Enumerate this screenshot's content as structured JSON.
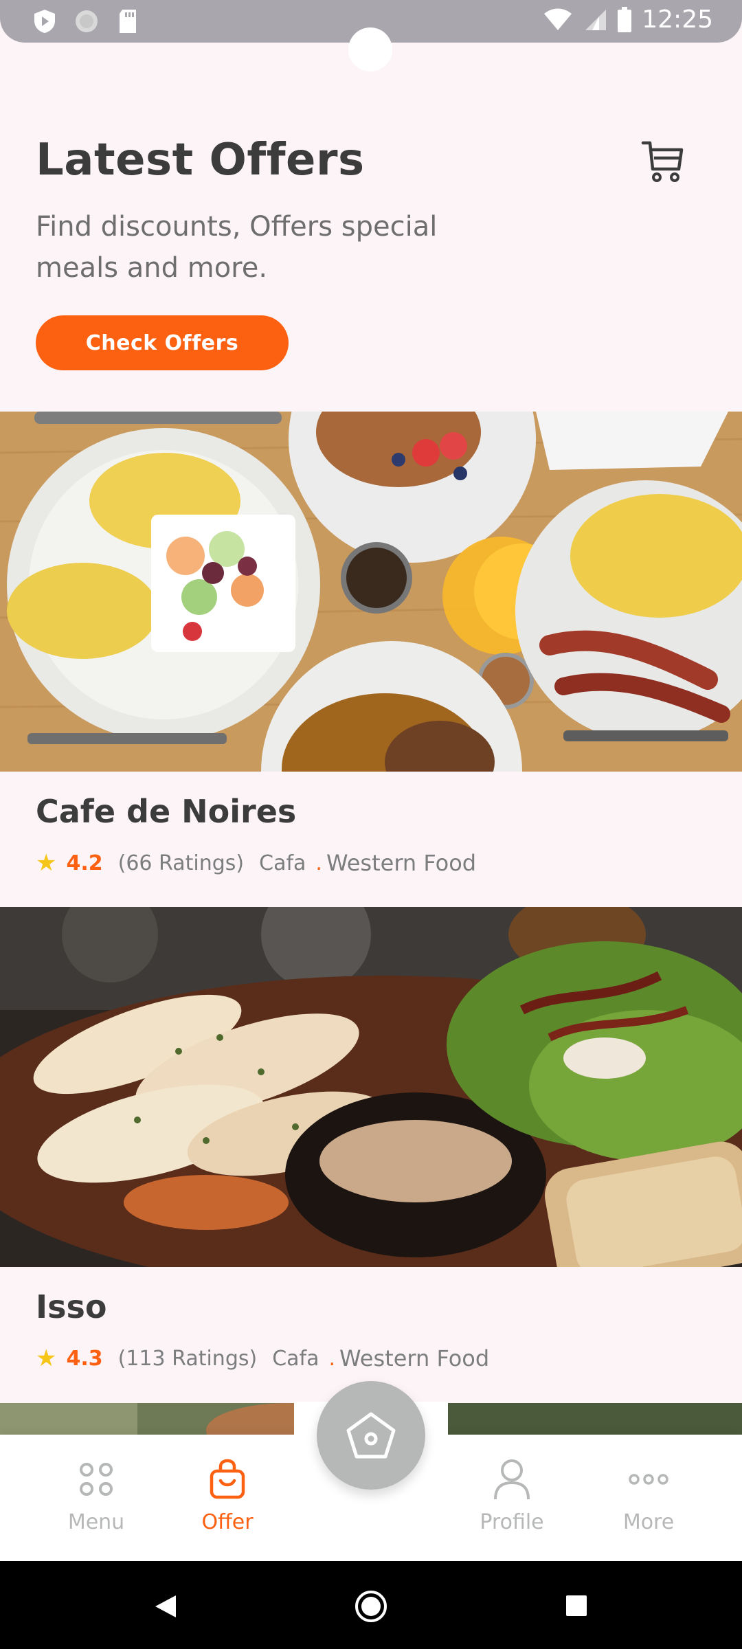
{
  "status_bar": {
    "time": "12:25"
  },
  "header": {
    "title": "Latest Offers",
    "subtitle": "Find discounts, Offers special meals and more.",
    "cta_label": "Check Offers",
    "cart_icon": "cart-icon"
  },
  "offers": [
    {
      "name": "Cafe de Noires",
      "rating": "4.2",
      "ratings_count": "(66 Ratings)",
      "type": "Cafa",
      "cuisine": "Western Food"
    },
    {
      "name": "Isso",
      "rating": "4.3",
      "ratings_count": "(113 Ratings)",
      "type": "Cafa",
      "cuisine": "Western Food"
    }
  ],
  "bottom_nav": {
    "items": [
      {
        "label": "Menu",
        "icon": "grid-icon",
        "active": false
      },
      {
        "label": "Offer",
        "icon": "bag-icon",
        "active": true
      },
      {
        "label": "Profile",
        "icon": "person-icon",
        "active": false
      },
      {
        "label": "More",
        "icon": "more-icon",
        "active": false
      }
    ],
    "center_icon": "home-icon"
  },
  "colors": {
    "accent": "#fc6011",
    "star": "#f5c518",
    "background": "#fdf4f8"
  }
}
